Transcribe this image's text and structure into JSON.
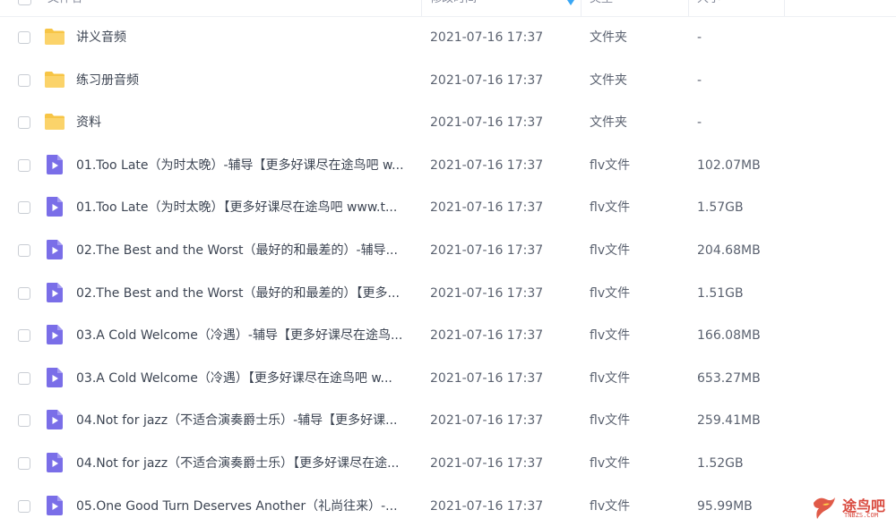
{
  "header": {
    "col_name": "文件名",
    "col_time": "修改时间",
    "col_type": "类型",
    "col_size": "大小"
  },
  "files": [
    {
      "name": "讲义音频",
      "time": "2021-07-16 17:37",
      "type": "文件夹",
      "size": "-",
      "icon": "folder-icon"
    },
    {
      "name": "练习册音频",
      "time": "2021-07-16 17:37",
      "type": "文件夹",
      "size": "-",
      "icon": "folder-icon"
    },
    {
      "name": "资料",
      "time": "2021-07-16 17:37",
      "type": "文件夹",
      "size": "-",
      "icon": "folder-icon"
    },
    {
      "name": "01.Too Late（为时太晚）-辅导【更多好课尽在途鸟吧 w...",
      "time": "2021-07-16 17:37",
      "type": "flv文件",
      "size": "102.07MB",
      "icon": "video-file-icon"
    },
    {
      "name": "01.Too Late（为时太晚）【更多好课尽在途鸟吧 www.t...",
      "time": "2021-07-16 17:37",
      "type": "flv文件",
      "size": "1.57GB",
      "icon": "video-file-icon"
    },
    {
      "name": "02.The Best and the Worst（最好的和最差的）-辅导...",
      "time": "2021-07-16 17:37",
      "type": "flv文件",
      "size": "204.68MB",
      "icon": "video-file-icon"
    },
    {
      "name": "02.The Best and the Worst（最好的和最差的）【更多...",
      "time": "2021-07-16 17:37",
      "type": "flv文件",
      "size": "1.51GB",
      "icon": "video-file-icon"
    },
    {
      "name": "03.A Cold Welcome（冷遇）-辅导【更多好课尽在途鸟...",
      "time": "2021-07-16 17:37",
      "type": "flv文件",
      "size": "166.08MB",
      "icon": "video-file-icon"
    },
    {
      "name": "03.A Cold Welcome（冷遇）【更多好课尽在途鸟吧 w...",
      "time": "2021-07-16 17:37",
      "type": "flv文件",
      "size": "653.27MB",
      "icon": "video-file-icon"
    },
    {
      "name": "04.Not for jazz（不适合演奏爵士乐）-辅导【更多好课...",
      "time": "2021-07-16 17:37",
      "type": "flv文件",
      "size": "259.41MB",
      "icon": "video-file-icon"
    },
    {
      "name": "04.Not for jazz（不适合演奏爵士乐）【更多好课尽在途...",
      "time": "2021-07-16 17:37",
      "type": "flv文件",
      "size": "1.52GB",
      "icon": "video-file-icon"
    },
    {
      "name": "05.One Good Turn Deserves Another（礼尚往来）-...",
      "time": "2021-07-16 17:37",
      "type": "flv文件",
      "size": "95.99MB",
      "icon": "video-file-icon"
    }
  ],
  "watermark": {
    "text": "途鸟吧",
    "sub": "TNBZS.COM"
  },
  "colors": {
    "folder": "#f7c546",
    "video": "#7a6ee8",
    "sort_accent": "#3aa7f5"
  }
}
